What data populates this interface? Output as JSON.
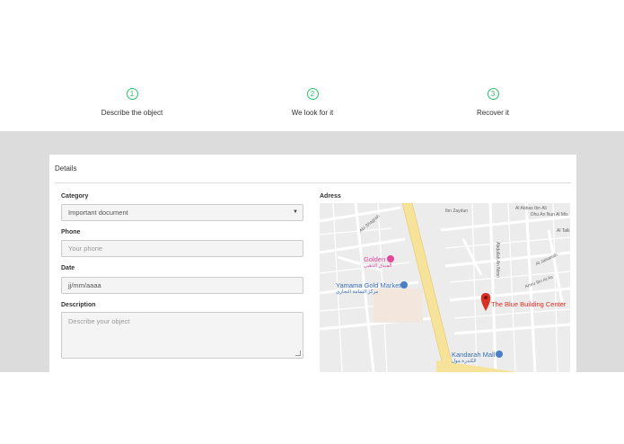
{
  "steps": [
    {
      "number": "1",
      "label": "Describe the object"
    },
    {
      "number": "2",
      "label": "We look for it"
    },
    {
      "number": "3",
      "label": "Recover it"
    }
  ],
  "card": {
    "title": "Details"
  },
  "form": {
    "category": {
      "label": "Category",
      "value": "Important document"
    },
    "phone": {
      "label": "Phone",
      "placeholder": "Your phone"
    },
    "date": {
      "label": "Date",
      "placeholder": "jj/mm/aaaa"
    },
    "description": {
      "label": "Description",
      "placeholder": "Describe your object"
    }
  },
  "address": {
    "label": "Adress"
  },
  "map": {
    "marker_label": "The Blue Building Center",
    "pois": [
      {
        "name": "Golden",
        "arabic": "الفندق الذهبي"
      },
      {
        "name": "Yamama Gold Market",
        "arabic": "مركز اليمامة التجاري"
      },
      {
        "name": "Kandarah Mall",
        "arabic": "الكندرة مول"
      }
    ],
    "streets": [
      "Abi Shagrah",
      "Ibn Zaydun",
      "Al Abbas Ibn Ali",
      "Dhu An Nun Al Mis",
      "Abdullah An Nimri",
      "Al Jaisariah",
      "Amru Ibn Al As",
      "Al Talk"
    ]
  },
  "colors": {
    "accent": "#2bbf6a",
    "band": "#dcdcdc",
    "road": "#f7e29a",
    "marker": "#d93025"
  }
}
